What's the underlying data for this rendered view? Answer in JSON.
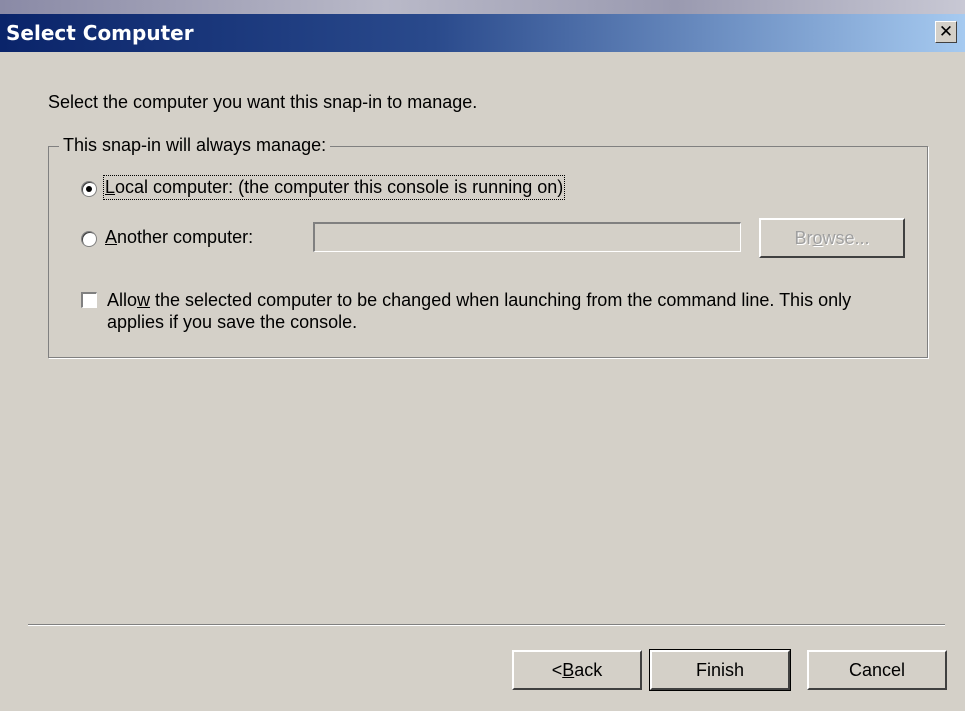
{
  "window": {
    "title": "Select Computer"
  },
  "prompt": "Select the computer you want this snap-in to manage.",
  "group": {
    "legend": "This snap-in will always manage:",
    "local_option": {
      "accel": "L",
      "rest": "ocal computer:  (the computer this console is running on)",
      "checked": true
    },
    "another_option": {
      "accel": "A",
      "rest": "nother computer:",
      "checked": false,
      "value": ""
    },
    "browse_button": {
      "pre": "Br",
      "accel": "o",
      "post": "wse...",
      "enabled": false
    },
    "allow_checkbox": {
      "pre": "Allo",
      "accel": "w",
      "post": " the selected computer to be changed when launching from the command line.  This only applies if you save the console.",
      "checked": false
    }
  },
  "footer": {
    "back_button": {
      "pre": "< ",
      "accel": "B",
      "post": "ack"
    },
    "finish_button": "Finish",
    "cancel_button": "Cancel"
  },
  "icons": {
    "close": "close-icon"
  }
}
